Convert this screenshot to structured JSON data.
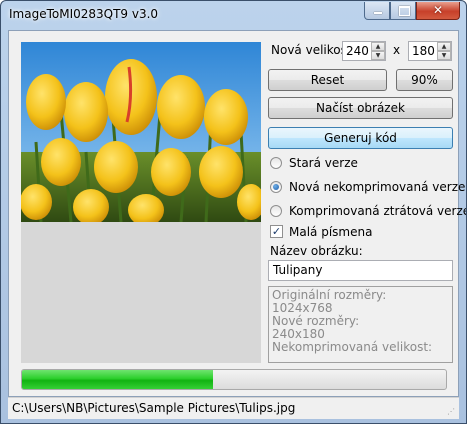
{
  "window": {
    "title": "ImageToMI0283QT9 v3.0",
    "caption": {
      "minimize_icon": "minimize-icon",
      "maximize_icon": "maximize-icon",
      "close_icon": "close-icon",
      "close_glyph": "✕"
    }
  },
  "size": {
    "label": "Nová velikost:",
    "width": "240",
    "separator": "x",
    "height": "180"
  },
  "buttons": {
    "reset": "Reset",
    "percent": "90%",
    "load": "Načíst obrázek",
    "generate": "Generuj kód"
  },
  "options": {
    "radios": [
      {
        "label": "Stará verze",
        "selected": false
      },
      {
        "label": "Nová nekomprimovaná verze",
        "selected": true
      },
      {
        "label": "Komprimovaná ztrátová verze",
        "selected": false
      }
    ],
    "lowercase": {
      "label": "Malá písmena",
      "checked": true,
      "mark": "✓"
    }
  },
  "image_name": {
    "label": "Název obrázku:",
    "value": "Tulipany"
  },
  "info": {
    "original_label": "Originální rozměry:",
    "original_value": "1024x768",
    "new_label": "Nové rozměry:",
    "new_value": "240x180",
    "uncompressed_label": "Nekomprimovaná velikost:"
  },
  "progress": {
    "value": 0.45
  },
  "status": {
    "path": "C:\\Users\\NB\\Pictures\\Sample Pictures\\Tulips.jpg"
  },
  "colors": {
    "progress_fill": "#22c322",
    "primary_button": "#bee6fd",
    "sky": "#4a9be0",
    "tulip": "#f4c21a"
  }
}
